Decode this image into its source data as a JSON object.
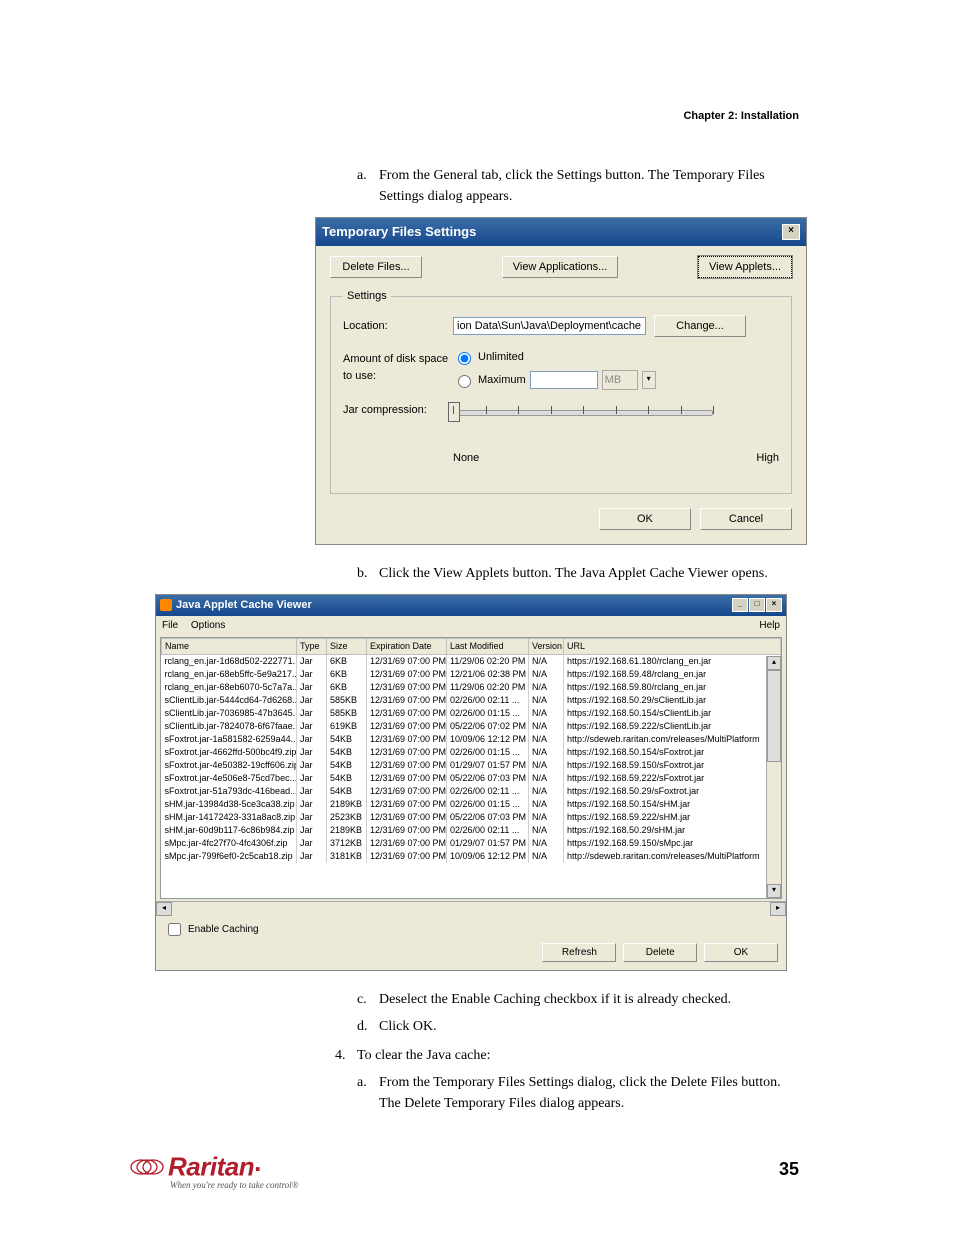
{
  "header": {
    "chapter": "Chapter 2: Installation"
  },
  "steps": {
    "a_intro": {
      "marker": "a.",
      "text": "From the General tab, click the Settings button. The Temporary Files Settings dialog appears."
    },
    "b_view": {
      "marker": "b.",
      "text": "Click the View Applets button. The Java Applet Cache Viewer opens."
    },
    "c_deselect": {
      "marker": "c.",
      "text": "Deselect the Enable Caching checkbox if it is already checked."
    },
    "d_ok": {
      "marker": "d.",
      "text": "Click OK."
    },
    "step4": {
      "marker": "4.",
      "text": "To clear the Java cache:"
    },
    "a_clear": {
      "marker": "a.",
      "text": "From the Temporary Files Settings dialog, click the Delete Files button. The Delete Temporary Files dialog appears."
    }
  },
  "dialog1": {
    "title": "Temporary Files Settings",
    "delete_files": "Delete Files...",
    "view_applications": "View Applications...",
    "view_applets": "View Applets...",
    "settings_legend": "Settings",
    "location_label": "Location:",
    "location_value": "ion Data\\Sun\\Java\\Deployment\\cache",
    "change": "Change...",
    "disk_label": "Amount of disk space to use:",
    "unlimited": "Unlimited",
    "maximum": "Maximum",
    "mb": "MB",
    "compression_label": "Jar compression:",
    "slider_none": "None",
    "slider_high": "High",
    "ok": "OK",
    "cancel": "Cancel"
  },
  "cache": {
    "title": "Java Applet Cache Viewer",
    "menu_file": "File",
    "menu_options": "Options",
    "menu_help": "Help",
    "columns": [
      "Name",
      "Type",
      "Size",
      "Expiration Date",
      "Last Modified",
      "Version",
      "URL"
    ],
    "rows": [
      {
        "name": "rclang_en.jar-1d68d502-222771...",
        "type": "Jar",
        "size": "6KB",
        "exp": "12/31/69 07:00 PM",
        "mod": "11/29/06 02:20 PM",
        "ver": "N/A",
        "url": "https://192.168.61.180/rclang_en.jar"
      },
      {
        "name": "rclang_en.jar-68eb5ffc-5e9a217...",
        "type": "Jar",
        "size": "6KB",
        "exp": "12/31/69 07:00 PM",
        "mod": "12/21/06 02:38 PM",
        "ver": "N/A",
        "url": "https://192.168.59.48/rclang_en.jar"
      },
      {
        "name": "rclang_en.jar-68eb6070-5c7a7a...",
        "type": "Jar",
        "size": "6KB",
        "exp": "12/31/69 07:00 PM",
        "mod": "11/29/06 02:20 PM",
        "ver": "N/A",
        "url": "https://192.168.59.80/rclang_en.jar"
      },
      {
        "name": "sClientLib.jar-5444cd64-7d6268...",
        "type": "Jar",
        "size": "585KB",
        "exp": "12/31/69 07:00 PM",
        "mod": "02/26/00 02:11 ...",
        "ver": "N/A",
        "url": "https://192.168.50.29/sClientLib.jar"
      },
      {
        "name": "sClientLib.jar-7036985-47b3645...",
        "type": "Jar",
        "size": "585KB",
        "exp": "12/31/69 07:00 PM",
        "mod": "02/26/00 01:15 ...",
        "ver": "N/A",
        "url": "https://192.168.50.154/sClientLib.jar"
      },
      {
        "name": "sClientLib.jar-7824078-6f67faae...",
        "type": "Jar",
        "size": "619KB",
        "exp": "12/31/69 07:00 PM",
        "mod": "05/22/06 07:02 PM",
        "ver": "N/A",
        "url": "https://192.168.59.222/sClientLib.jar"
      },
      {
        "name": "sFoxtrot.jar-1a581582-6259a44...",
        "type": "Jar",
        "size": "54KB",
        "exp": "12/31/69 07:00 PM",
        "mod": "10/09/06 12:12 PM",
        "ver": "N/A",
        "url": "http://sdeweb.raritan.com/releases/MultiPlatform"
      },
      {
        "name": "sFoxtrot.jar-4662ffd-500bc4f9.zip",
        "type": "Jar",
        "size": "54KB",
        "exp": "12/31/69 07:00 PM",
        "mod": "02/26/00 01:15 ...",
        "ver": "N/A",
        "url": "https://192.168.50.154/sFoxtrot.jar"
      },
      {
        "name": "sFoxtrot.jar-4e50382-19cff606.zip",
        "type": "Jar",
        "size": "54KB",
        "exp": "12/31/69 07:00 PM",
        "mod": "01/29/07 01:57 PM",
        "ver": "N/A",
        "url": "https://192.168.59.150/sFoxtrot.jar"
      },
      {
        "name": "sFoxtrot.jar-4e506e8-75cd7bec...",
        "type": "Jar",
        "size": "54KB",
        "exp": "12/31/69 07:00 PM",
        "mod": "05/22/06 07:03 PM",
        "ver": "N/A",
        "url": "https://192.168.59.222/sFoxtrot.jar"
      },
      {
        "name": "sFoxtrot.jar-51a793dc-416bead...",
        "type": "Jar",
        "size": "54KB",
        "exp": "12/31/69 07:00 PM",
        "mod": "02/26/00 02:11 ...",
        "ver": "N/A",
        "url": "https://192.168.50.29/sFoxtrot.jar"
      },
      {
        "name": "sHM.jar-13984d38-5ce3ca38.zip",
        "type": "Jar",
        "size": "2189KB",
        "exp": "12/31/69 07:00 PM",
        "mod": "02/26/00 01:15 ...",
        "ver": "N/A",
        "url": "https://192.168.50.154/sHM.jar"
      },
      {
        "name": "sHM.jar-14172423-331a8ac8.zip",
        "type": "Jar",
        "size": "2523KB",
        "exp": "12/31/69 07:00 PM",
        "mod": "05/22/06 07:03 PM",
        "ver": "N/A",
        "url": "https://192.168.59.222/sHM.jar"
      },
      {
        "name": "sHM.jar-60d9b117-6c86b984.zip",
        "type": "Jar",
        "size": "2189KB",
        "exp": "12/31/69 07:00 PM",
        "mod": "02/26/00 02:11 ...",
        "ver": "N/A",
        "url": "https://192.168.50.29/sHM.jar"
      },
      {
        "name": "sMpc.jar-4fc27f70-4fc4306f.zip",
        "type": "Jar",
        "size": "3712KB",
        "exp": "12/31/69 07:00 PM",
        "mod": "01/29/07 01:57 PM",
        "ver": "N/A",
        "url": "https://192.168.59.150/sMpc.jar"
      },
      {
        "name": "sMpc.jar-799f6ef0-2c5cab18.zip",
        "type": "Jar",
        "size": "3181KB",
        "exp": "12/31/69 07:00 PM",
        "mod": "10/09/06 12:12 PM",
        "ver": "N/A",
        "url": "http://sdeweb.raritan.com/releases/MultiPlatform"
      }
    ],
    "enable_caching": "Enable Caching",
    "refresh": "Refresh",
    "delete": "Delete",
    "ok": "OK"
  },
  "footer": {
    "brand": "Raritan",
    "tagline": "When you're ready to take control®",
    "page": "35"
  }
}
